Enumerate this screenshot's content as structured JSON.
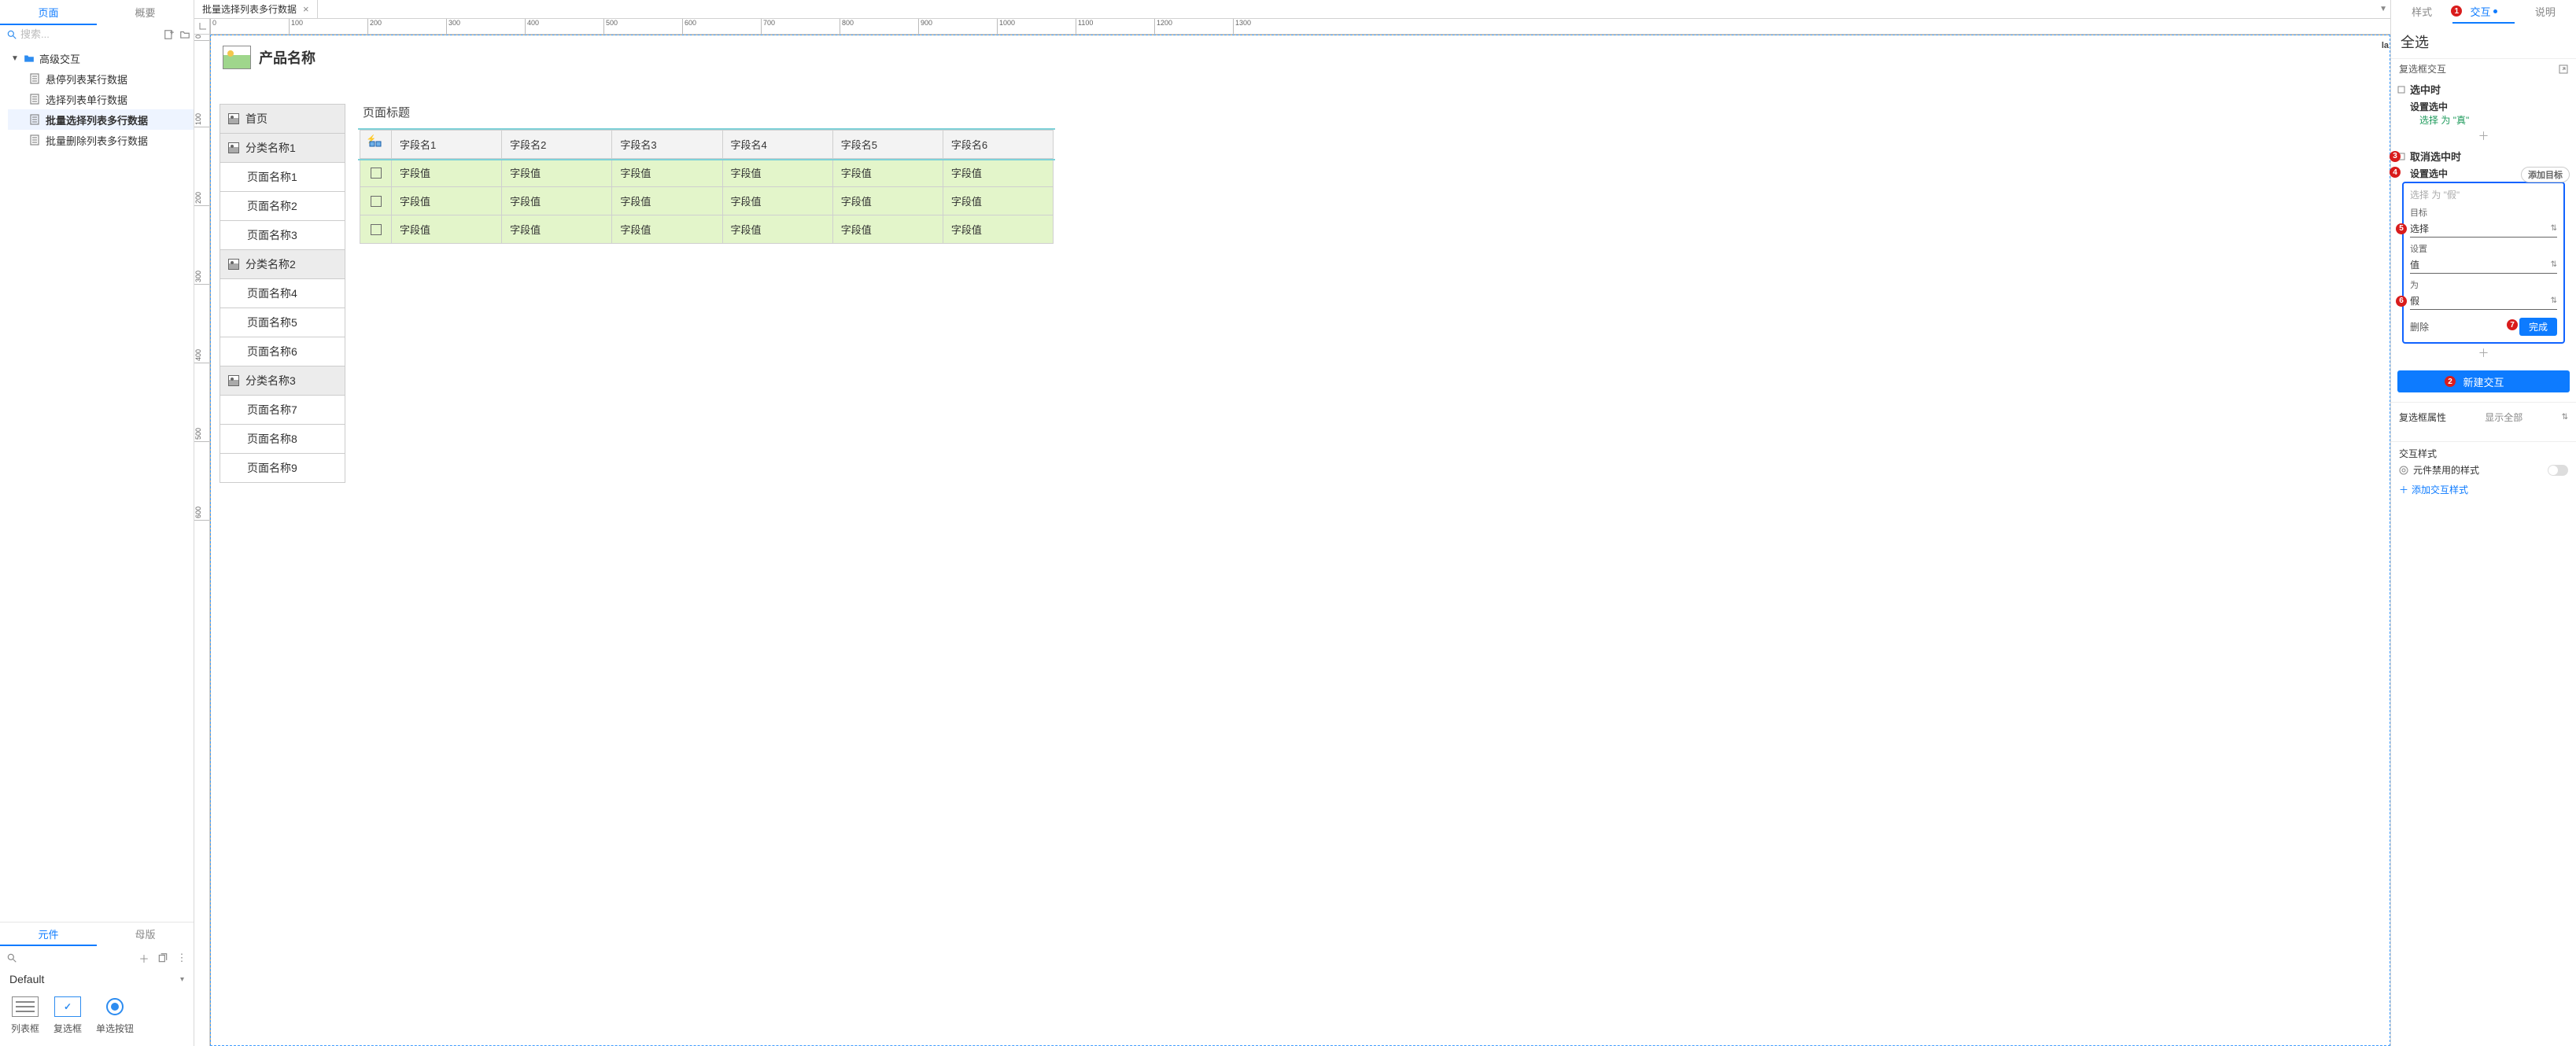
{
  "left": {
    "tabs": [
      "页面",
      "概要"
    ],
    "active_tab": 0,
    "search_placeholder": "搜索...",
    "tree": {
      "folder": "高级交互",
      "pages": [
        "悬停列表某行数据",
        "选择列表单行数据",
        "批量选择列表多行数据",
        "批量删除列表多行数据"
      ],
      "selected_index": 2
    },
    "lower_tabs": [
      "元件",
      "母版"
    ],
    "lower_active": 0,
    "library": "Default",
    "widgets": [
      {
        "name": "listbox",
        "label": "列表框"
      },
      {
        "name": "checkbox",
        "label": "复选框"
      },
      {
        "name": "radio",
        "label": "单选按钮"
      }
    ]
  },
  "center": {
    "doc_tab": "批量选择列表多行数据",
    "h_ticks": [
      0,
      100,
      200,
      300,
      400,
      500,
      600,
      700,
      800,
      900,
      1000,
      1100,
      1200,
      1300
    ],
    "v_ticks": [
      0,
      100,
      200,
      300,
      400,
      500,
      600
    ],
    "edge_label": "la",
    "product_title": "产品名称",
    "page_title": "页面标题",
    "nav": [
      {
        "type": "section",
        "label": "首页"
      },
      {
        "type": "section",
        "label": "分类名称1"
      },
      {
        "type": "sub",
        "label": "页面名称1"
      },
      {
        "type": "sub",
        "label": "页面名称2"
      },
      {
        "type": "sub",
        "label": "页面名称3"
      },
      {
        "type": "section",
        "label": "分类名称2"
      },
      {
        "type": "sub",
        "label": "页面名称4"
      },
      {
        "type": "sub",
        "label": "页面名称5"
      },
      {
        "type": "sub",
        "label": "页面名称6"
      },
      {
        "type": "section",
        "label": "分类名称3"
      },
      {
        "type": "sub",
        "label": "页面名称7"
      },
      {
        "type": "sub",
        "label": "页面名称8"
      },
      {
        "type": "sub",
        "label": "页面名称9"
      }
    ],
    "table": {
      "columns": [
        "字段名1",
        "字段名2",
        "字段名3",
        "字段名4",
        "字段名5",
        "字段名6"
      ],
      "cell": "字段值",
      "rows": 3
    }
  },
  "right": {
    "tabs": [
      "样式",
      "交互",
      "说明"
    ],
    "active_tab": 1,
    "selection_name": "全选",
    "section_label": "复选框交互",
    "events": {
      "checked": "选中时",
      "unchecked": "取消选中时",
      "action": "设置选中",
      "detail_prefix": "选择",
      "detail_mid": " 为 ",
      "true_val": "\"真\"",
      "false_hint": "选择 为 \"假\""
    },
    "add_target": "添加目标",
    "edit": {
      "target_label": "目标",
      "target_value": "选择",
      "set_label": "设置",
      "set_value": "值",
      "to_label": "为",
      "to_value": "假",
      "delete": "删除",
      "done": "完成"
    },
    "new_interaction": "新建交互",
    "prop_section": "复选框属性",
    "show_all": "显示全部",
    "ix_style_section": "交互样式",
    "disabled_style": "元件禁用的样式",
    "add_ix_style": "添加交互样式",
    "badges": {
      "1": "1",
      "2": "2",
      "3": "3",
      "4": "4",
      "5": "5",
      "6": "6",
      "7": "7"
    }
  }
}
